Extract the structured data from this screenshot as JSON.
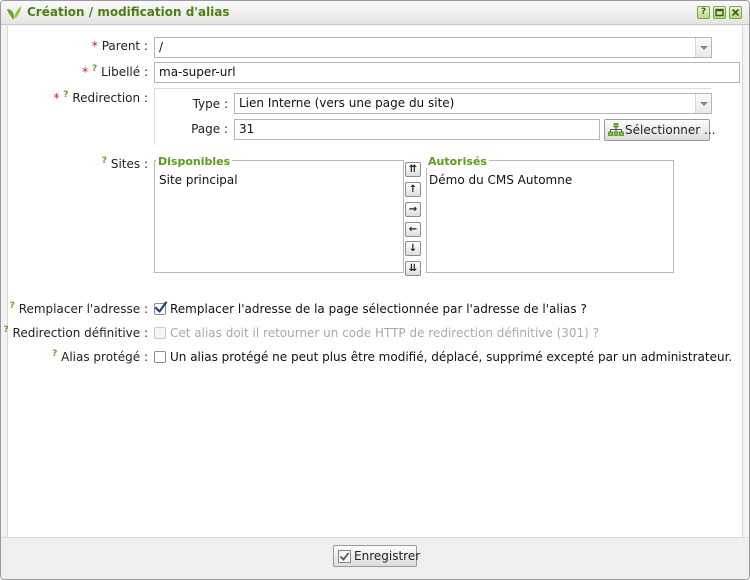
{
  "window": {
    "title": "Création / modification d'alias",
    "help_icon": "?",
    "colors": {
      "title": "#4f7d12",
      "accent": "#5e9a1c",
      "required": "#d11a1a"
    }
  },
  "form": {
    "required_mark": "*",
    "help_mark": "?",
    "parent": {
      "label": "Parent :",
      "value": "/"
    },
    "libelle": {
      "label": "Libellé :",
      "value": "ma-super-url"
    },
    "redirection": {
      "label": "Redirection :",
      "type_label": "Type :",
      "type_value": "Lien Interne (vers une page du site)",
      "page_label": "Page :",
      "page_value": "31",
      "select_button": "Sélectionner ..."
    },
    "sites": {
      "label": "Sites :",
      "available_legend": "Disponibles",
      "available_items": [
        "Site principal"
      ],
      "authorized_legend": "Autorisés",
      "authorized_items": [
        "Démo du CMS Automne"
      ]
    },
    "replace_address": {
      "label": "Remplacer l'adresse :",
      "text": "Remplacer l'adresse de la page sélectionnée par l'adresse de l'alias ?",
      "checked": true
    },
    "permanent_redirect": {
      "label": "Redirection définitive :",
      "text": "Cet alias doit il retourner un code HTTP de redirection définitive (301) ?",
      "checked": false,
      "disabled": true
    },
    "protected_alias": {
      "label": "Alias protégé :",
      "text": "Un alias protégé ne peut plus être modifié, déplacé, supprimé excepté par un administrateur.",
      "checked": false
    }
  },
  "footer": {
    "save_button": "Enregistrer"
  }
}
